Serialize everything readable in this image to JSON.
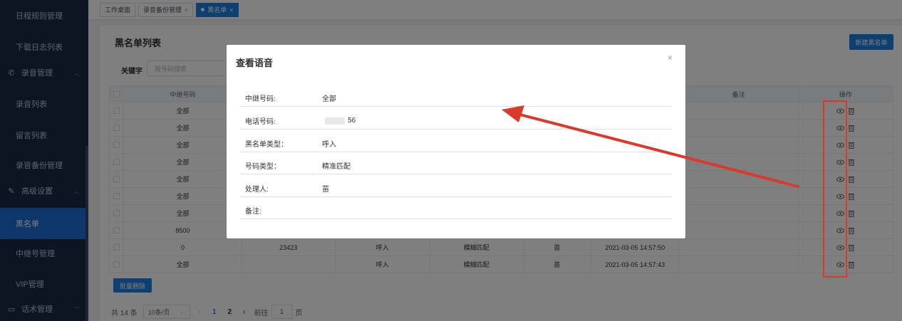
{
  "sidebar": {
    "items": [
      {
        "label": "日程规则管理",
        "type": "item"
      },
      {
        "label": "下载日志列表",
        "type": "item"
      },
      {
        "label": "录音管理",
        "type": "group",
        "icon": "phone-icon"
      },
      {
        "label": "录音列表",
        "type": "item"
      },
      {
        "label": "留言列表",
        "type": "item"
      },
      {
        "label": "录音备份管理",
        "type": "item"
      },
      {
        "label": "高级设置",
        "type": "group",
        "icon": "pen-icon"
      },
      {
        "label": "黑名单",
        "type": "item",
        "active": true
      },
      {
        "label": "中继号管理",
        "type": "item"
      },
      {
        "label": "VIP管理",
        "type": "item"
      },
      {
        "label": "话术管理",
        "type": "group",
        "icon": "chat-icon"
      }
    ]
  },
  "tabs": [
    {
      "label": "工作桌面",
      "closable": false
    },
    {
      "label": "录音备份管理",
      "closable": true
    },
    {
      "label": "黑名单",
      "closable": true,
      "active": true
    }
  ],
  "page": {
    "title": "黑名单列表",
    "new_button": "新建黑名单",
    "keyword_label": "关键字",
    "keyword_placeholder": "按号码搜索",
    "batch_delete": "批量删除"
  },
  "table": {
    "headers": {
      "trunk": "中继号码",
      "note": "备注",
      "op": "操作"
    },
    "rows": [
      {
        "trunk": "全部",
        "phone": "",
        "type": "",
        "match": "",
        "handler": "",
        "time": ""
      },
      {
        "trunk": "全部",
        "phone": "",
        "type": "",
        "match": "",
        "handler": "",
        "time": ""
      },
      {
        "trunk": "全部",
        "phone": "",
        "type": "",
        "match": "",
        "handler": "",
        "time": ""
      },
      {
        "trunk": "全部",
        "phone": "",
        "type": "",
        "match": "",
        "handler": "",
        "time": ""
      },
      {
        "trunk": "全部",
        "phone": "",
        "type": "",
        "match": "",
        "handler": "",
        "time": ""
      },
      {
        "trunk": "全部",
        "phone": "",
        "type": "",
        "match": "",
        "handler": "",
        "time": ""
      },
      {
        "trunk": "全部",
        "phone": "",
        "type": "",
        "match": "",
        "handler": "",
        "time": ""
      },
      {
        "trunk": "8500",
        "phone": "",
        "type": "",
        "match": "",
        "handler": "",
        "time": ""
      },
      {
        "trunk": "0",
        "phone": "23423",
        "type": "呼入",
        "match": "模糊匹配",
        "handler": "苗",
        "time": "2021-03-05 14:57:50"
      },
      {
        "trunk": "全部",
        "phone": "",
        "type": "呼入",
        "match": "模糊匹配",
        "handler": "苗",
        "time": "2021-03-05 14:57:43"
      }
    ]
  },
  "pager": {
    "total": "共 14 条",
    "page_size": "10条/页",
    "pages": [
      "1",
      "2"
    ],
    "current": "1",
    "goto_label": "前往",
    "goto_value": "1",
    "goto_suffix": "页"
  },
  "dialog": {
    "title": "查看语音",
    "close": "×",
    "fields": [
      {
        "label": "中继号码:",
        "value": "全部"
      },
      {
        "label": "电话号码:",
        "value": "56"
      },
      {
        "label": "黑名单类型：",
        "value": "呼入"
      },
      {
        "label": "号码类型：",
        "value": "精准匹配"
      },
      {
        "label": "处理人:",
        "value": "苗"
      },
      {
        "label": "备注:",
        "value": ""
      }
    ]
  },
  "colors": {
    "accent": "#1a7ee0",
    "sidebar": "#1d2b45",
    "annotation": "#d93a2b"
  }
}
